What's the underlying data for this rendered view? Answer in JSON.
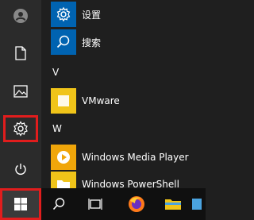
{
  "start_menu": {
    "apps": [
      {
        "label": "设置",
        "icon": "gear-icon"
      },
      {
        "label": "搜索",
        "icon": "search-icon"
      },
      {
        "letter": "V"
      },
      {
        "label": "VMware",
        "icon": "vmware-icon"
      },
      {
        "letter": "W"
      },
      {
        "label": "Windows Media Player",
        "icon": "media-player-icon"
      },
      {
        "label": "Windows PowerShell",
        "icon": "folder-icon"
      }
    ],
    "rail": {
      "items": [
        "user-icon",
        "document-icon",
        "pictures-icon",
        "gear-icon",
        "power-icon"
      ]
    }
  },
  "taskbar": {
    "items": [
      "windows-logo-icon",
      "search-icon",
      "task-view-icon",
      "firefox-icon",
      "file-explorer-icon",
      "app-icon"
    ]
  },
  "colors": {
    "highlight": "#e11d1d",
    "tile_blue": "#0063b1",
    "tile_yellow": "#f0c419"
  }
}
